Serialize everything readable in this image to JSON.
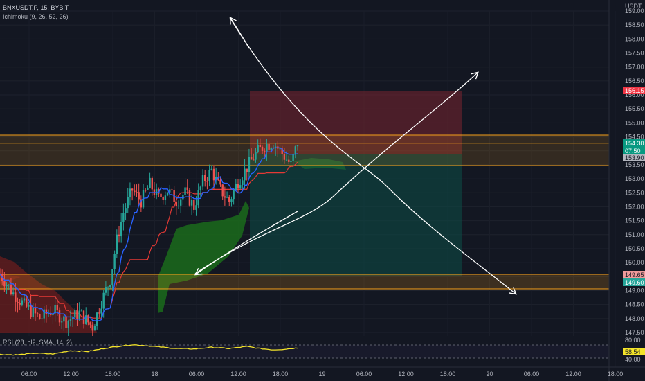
{
  "header": {
    "symbol": "BNXUSDT.P, 15, BYBIT",
    "indicator": "Ichimoku (9, 26, 52, 26)",
    "currency": "USDT"
  },
  "rsi": {
    "label": "RSI (28, hl2, SMA, 14, 2)",
    "levels": [
      "80.00",
      "40.00"
    ],
    "value_badge": "58.54"
  },
  "price_badges": {
    "stop": "156.15",
    "last": "154.30",
    "countdown": "07:50",
    "entry": "153.90",
    "level_a": "149.65",
    "level_b": "149.60"
  },
  "colors": {
    "background": "#131722",
    "up": "#26a69a",
    "down": "#ef5350",
    "zone": "#f7a21b",
    "cloud_bull": "#1b6b1b",
    "cloud_bear": "#6b1d1d",
    "tenkan": "#2962ff",
    "kijun": "#e53935",
    "rsi_line": "#f5e52a",
    "arrows": "#ffffff"
  },
  "chart_data": {
    "type": "candlestick",
    "title": "BNXUSDT.P, 15, BYBIT",
    "y_axis": {
      "unit": "USDT",
      "ylim": [
        147.5,
        159.0
      ],
      "ticks": [
        "159.00",
        "158.50",
        "158.00",
        "157.50",
        "157.00",
        "156.50",
        "156.00",
        "155.50",
        "155.00",
        "154.50",
        "154.00",
        "153.50",
        "153.00",
        "152.50",
        "152.00",
        "151.50",
        "151.00",
        "150.50",
        "150.00",
        "149.50",
        "149.00",
        "148.50",
        "148.00",
        "147.50"
      ]
    },
    "x_axis": {
      "ticks": [
        "06:00",
        "12:00",
        "18:00",
        "18",
        "06:00",
        "12:00",
        "18:00",
        "19",
        "06:00",
        "12:00",
        "18:00",
        "20",
        "06:00",
        "12:00",
        "18:00"
      ]
    },
    "zones": [
      {
        "name": "resistance zone",
        "from": 153.55,
        "to": 154.55
      },
      {
        "name": "support zone",
        "from": 149.1,
        "to": 149.7
      }
    ],
    "position": {
      "type": "short",
      "entry": 153.9,
      "stop": 156.15,
      "target": 149.65
    },
    "price_path": [
      [
        0,
        149.6
      ],
      [
        6,
        148.9
      ],
      [
        12,
        148.4
      ],
      [
        18,
        148.0
      ],
      [
        24,
        148.3
      ],
      [
        30,
        147.9
      ],
      [
        36,
        148.2
      ],
      [
        42,
        147.7
      ],
      [
        46,
        148.6
      ],
      [
        50,
        149.4
      ],
      [
        53,
        150.8
      ],
      [
        56,
        151.8
      ],
      [
        60,
        152.6
      ],
      [
        64,
        152.2
      ],
      [
        68,
        152.8
      ],
      [
        72,
        152.3
      ],
      [
        76,
        152.6
      ],
      [
        80,
        152.2
      ],
      [
        84,
        152.5
      ],
      [
        88,
        152.0
      ],
      [
        92,
        152.9
      ],
      [
        96,
        153.3
      ],
      [
        100,
        152.6
      ],
      [
        104,
        152.2
      ],
      [
        108,
        152.9
      ],
      [
        112,
        153.4
      ],
      [
        116,
        153.9
      ],
      [
        120,
        154.2
      ],
      [
        124,
        154.3
      ],
      [
        128,
        153.9
      ],
      [
        132,
        153.5
      ],
      [
        135,
        154.3
      ]
    ],
    "rsi_series": [
      [
        0,
        43
      ],
      [
        8,
        42
      ],
      [
        16,
        46
      ],
      [
        24,
        44
      ],
      [
        32,
        52
      ],
      [
        40,
        50
      ],
      [
        48,
        58
      ],
      [
        56,
        64
      ],
      [
        60,
        66
      ],
      [
        66,
        64
      ],
      [
        72,
        61
      ],
      [
        80,
        57
      ],
      [
        88,
        56
      ],
      [
        96,
        60
      ],
      [
        104,
        57
      ],
      [
        112,
        62
      ],
      [
        118,
        57
      ],
      [
        124,
        54
      ],
      [
        128,
        55
      ],
      [
        135,
        58.5
      ]
    ]
  }
}
